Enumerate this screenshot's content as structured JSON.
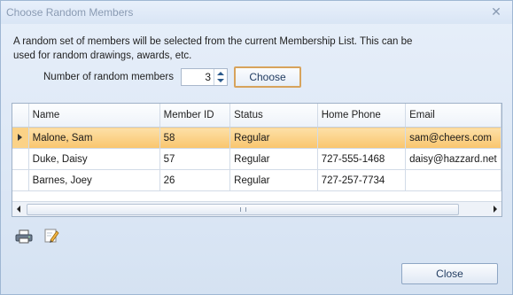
{
  "window": {
    "title": "Choose Random Members",
    "close_glyph": "✕"
  },
  "description": "A random set of members will be selected from the current Membership List.  This can be used for random drawings, awards, etc.",
  "number_field": {
    "label": "Number of random members",
    "value": "3"
  },
  "choose_button": "Choose",
  "grid": {
    "columns": [
      "Name",
      "Member ID",
      "Status",
      "Home Phone",
      "Email"
    ],
    "rows": [
      {
        "name": "Malone, Sam",
        "id": "58",
        "status": "Regular",
        "phone": "",
        "email": "sam@cheers.com"
      },
      {
        "name": "Duke, Daisy",
        "id": "57",
        "status": "Regular",
        "phone": "727-555-1468",
        "email": "daisy@hazzard.net"
      },
      {
        "name": "Barnes, Joey",
        "id": "26",
        "status": "Regular",
        "phone": "727-257-7734",
        "email": ""
      }
    ]
  },
  "icons": {
    "print": "printer-icon",
    "edit": "edit-icon"
  },
  "close_button": "Close",
  "colors": {
    "selected_row": "#f9c56d",
    "choose_border": "#d7a35c"
  }
}
